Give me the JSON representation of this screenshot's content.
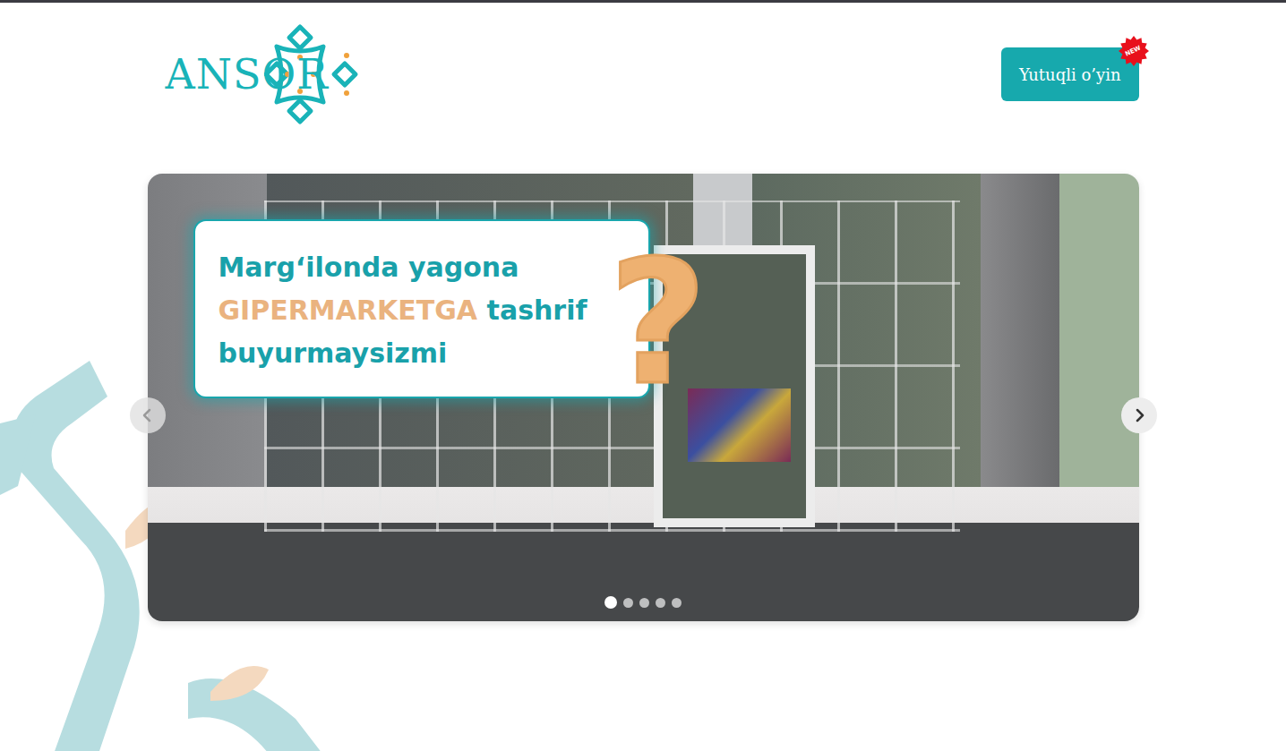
{
  "header": {
    "logo": "ANSOR",
    "game_button": "Yutuqli o’yin",
    "badge": "NEW"
  },
  "carousel": {
    "caption": [
      {
        "text": "Marg‘ilonda yagona",
        "highlight": false
      },
      {
        "text": "GIPERMARKETGA",
        "highlight": true
      },
      {
        "text": "tashrif",
        "highlight": false
      },
      {
        "text": "buyurmaysizmi",
        "highlight": false
      }
    ],
    "question_mark": "?",
    "slides": [
      {
        "selected": true
      },
      {
        "selected": false
      },
      {
        "selected": false
      },
      {
        "selected": false
      },
      {
        "selected": false
      }
    ]
  }
}
